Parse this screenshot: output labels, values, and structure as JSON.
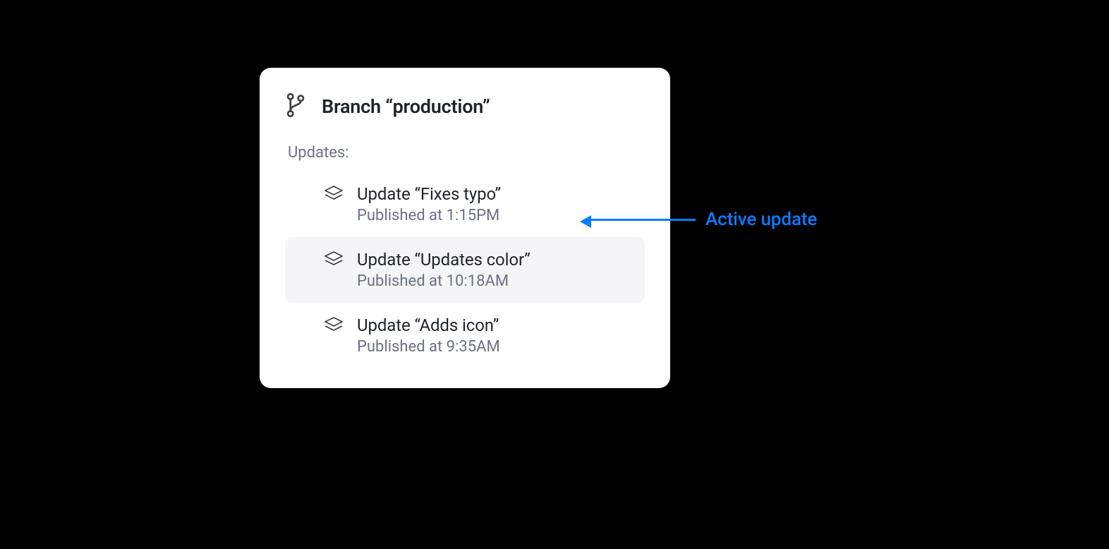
{
  "card": {
    "title": "Branch “production”",
    "section_label": "Updates:"
  },
  "updates": [
    {
      "title": "Update “Fixes typo”",
      "subtitle": "Published at 1:15PM",
      "highlight": false
    },
    {
      "title": "Update “Updates color”",
      "subtitle": "Published at 10:18AM",
      "highlight": true
    },
    {
      "title": "Update “Adds icon”",
      "subtitle": "Published at 9:35AM",
      "highlight": false
    }
  ],
  "annotation": {
    "label": "Active update"
  }
}
